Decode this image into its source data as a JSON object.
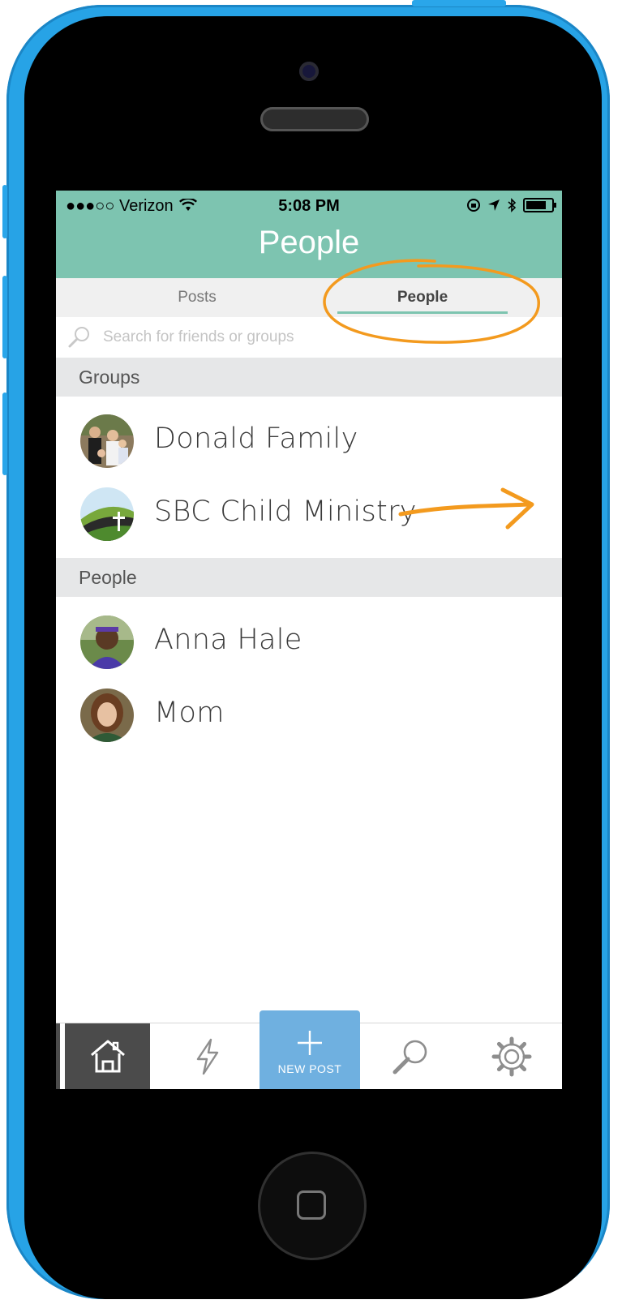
{
  "status_bar": {
    "carrier": "●●●○○ Verizon",
    "time": "5:08 PM"
  },
  "header": {
    "title": "People"
  },
  "tabs": [
    {
      "label": "Posts",
      "active": false
    },
    {
      "label": "People",
      "active": true
    }
  ],
  "search": {
    "placeholder": "Search for friends or groups",
    "value": ""
  },
  "sections": {
    "groups": {
      "title": "Groups",
      "items": [
        {
          "name": "Donald Family",
          "avatar": "family-photo"
        },
        {
          "name": "SBC Child Ministry",
          "avatar": "church-logo"
        }
      ]
    },
    "people": {
      "title": "People",
      "items": [
        {
          "name": "Anna Hale",
          "avatar": "child-photo"
        },
        {
          "name": "Mom",
          "avatar": "woman-photo"
        }
      ]
    }
  },
  "tabbar": {
    "items": [
      {
        "icon": "home-icon",
        "active": true
      },
      {
        "icon": "lightning-icon",
        "active": false
      },
      {
        "icon": "plus-icon",
        "label": "NEW POST"
      },
      {
        "icon": "search-icon",
        "active": false
      },
      {
        "icon": "gear-icon",
        "active": false
      }
    ]
  },
  "colors": {
    "accent": "#7dc4b0",
    "new_post": "#6fb0e0",
    "annotation": "#f39a1e",
    "phone_shell": "#27a3e6"
  }
}
